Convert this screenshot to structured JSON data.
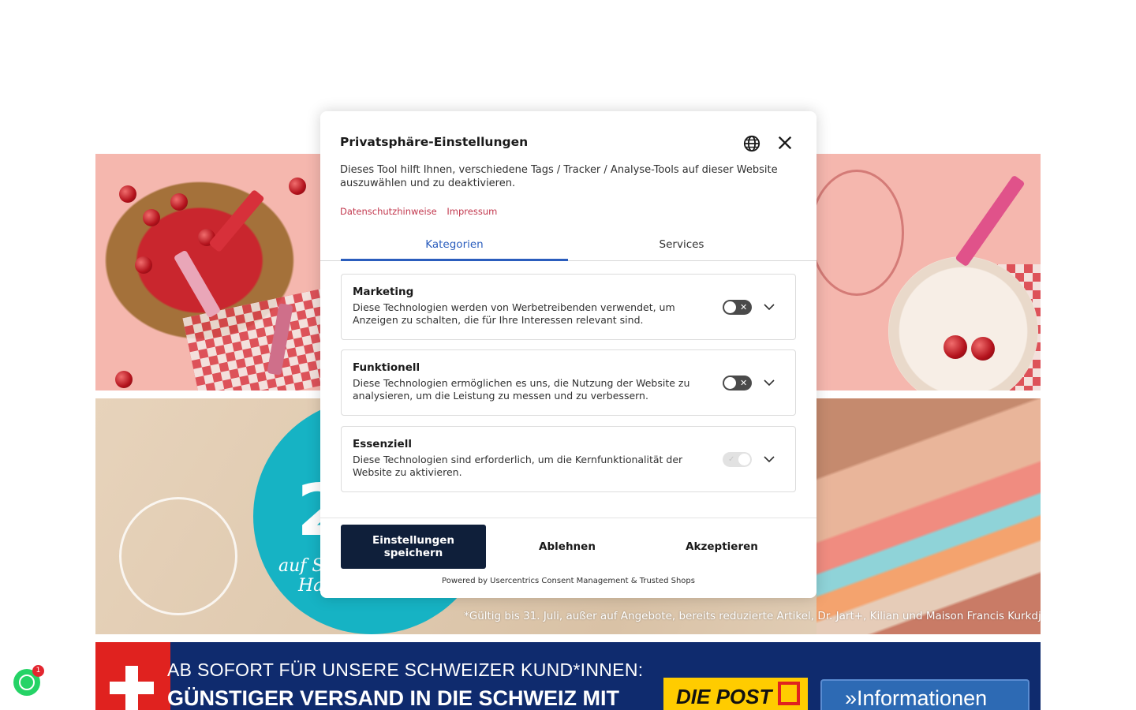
{
  "background": {
    "banner2_footnote": "*Gültig bis 31. Juli, außer auf Angebote, bereits reduzierte Artikel, Dr. Jart+, Kilian und Maison Francis Kurkdjian.",
    "banner2_partial_text": "auf Sc",
    "banner2_partial_text2": "Ha",
    "banner2_big": "2",
    "banner3_line1": "AB SOFORT FÜR UNSERE SCHWEIZER KUND*INNEN:",
    "banner3_line2": "GÜNSTIGER VERSAND IN DIE SCHWEIZ MIT",
    "banner3_post_logo": "DIE POST",
    "banner3_info_button": "»Informationen"
  },
  "whatsapp": {
    "badge_count": "1",
    "icon": "whatsapp-icon"
  },
  "consent_modal": {
    "title": "Privatsphäre-Einstellungen",
    "intro": "Dieses Tool hilft Ihnen, verschiedene Tags / Tracker / Analyse-Tools auf dieser Website auszuwählen und zu deaktivieren.",
    "links": [
      "Datenschutzhinweise",
      "Impressum"
    ],
    "tabs": [
      {
        "label": "Kategorien",
        "active": true
      },
      {
        "label": "Services",
        "active": false
      }
    ],
    "categories": [
      {
        "title": "Marketing",
        "description": "Diese Technologien werden von Werbetreibenden verwendet, um Anzeigen zu schalten, die für Ihre Interessen relevant sind.",
        "enabled": false,
        "locked": false
      },
      {
        "title": "Funktionell",
        "description": "Diese Technologien ermöglichen es uns, die Nutzung der Website zu analysieren, um die Leistung zu messen und zu verbessern.",
        "enabled": false,
        "locked": false
      },
      {
        "title": "Essenziell",
        "description": "Diese Technologien sind erforderlich, um die Kernfunktionalität der Website zu aktivieren.",
        "enabled": true,
        "locked": true
      }
    ],
    "buttons": {
      "save": "Einstellungen speichern",
      "deny": "Ablehnen",
      "accept": "Akzeptieren"
    },
    "powered_by": "Powered by Usercentrics Consent Management & Trusted Shops",
    "colors": {
      "accent": "#2a5dbd",
      "link": "#c2384e",
      "primary_button": "#0f1f3a"
    }
  }
}
